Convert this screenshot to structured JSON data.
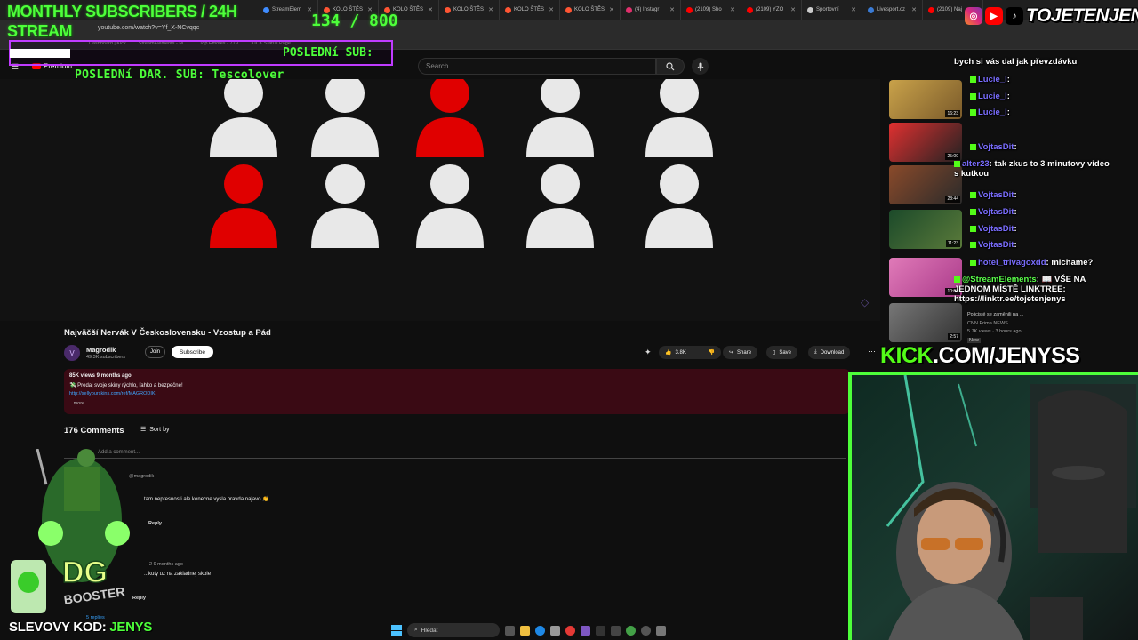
{
  "overlay": {
    "sub_goal_title": "MONTHLY SUBSCRIBERS / 24H",
    "sub_goal_title2": "STREAM",
    "sub_goal_count": "134  / 800",
    "last_sub_label": "POSLEDNí SUB:",
    "last_dar_label": "POSLEDNí DAR. SUB: Tescolover",
    "promo_prefix": "SLEVOVY KOD: ",
    "promo_code": "JENYS",
    "handle": "TOJETENJENYS",
    "kick_prefix": "KICK",
    "kick_suffix": ".COM/JENYSS"
  },
  "browser": {
    "tabs": [
      {
        "label": "StreamElem",
        "color": "#3f8cff"
      },
      {
        "label": "KOLO ŠTĚS",
        "color": "#ff5533"
      },
      {
        "label": "KOLO ŠTĚS",
        "color": "#ff5533"
      },
      {
        "label": "KOLO ŠTĚS",
        "color": "#ff5533"
      },
      {
        "label": "KOLO ŠTĚS",
        "color": "#ff5533"
      },
      {
        "label": "KOLO ŠTĚS",
        "color": "#ff5533"
      },
      {
        "label": "(4) Instagr",
        "color": "#e1306c"
      },
      {
        "label": "(2109) Sho",
        "color": "#ff0000"
      },
      {
        "label": "(2109) YZO",
        "color": "#ff0000"
      },
      {
        "label": "Sportovní",
        "color": "#cccccc"
      },
      {
        "label": "Livesport.cz",
        "color": "#3a7bd5"
      },
      {
        "label": "(2109) Naj",
        "color": "#ff0000"
      }
    ],
    "url": "youtube.com/watch?v=Yf_X-NCvqqc",
    "bookmarks": [
      "Dashboard | Kick",
      "StreamElements - M...",
      "Top Emotes - 7TV",
      "KICK Status Page"
    ]
  },
  "youtube": {
    "premium_label": "Premium",
    "search_placeholder": "Search",
    "video_title": "Najväčší Nervák V Československu - Vzostup a Pád",
    "channel_name": "Magrodik",
    "channel_subs": "49.3K subscribers",
    "join_label": "Join",
    "subscribe_label": "Subscribe",
    "likes": "3.8K",
    "share_label": "Share",
    "save_label": "Save",
    "download_label": "Download",
    "desc_meta": "85K views  9 months ago",
    "desc_line1": "💸 Predaj svoje skiny rýchlo, ľahko a bezpečne!",
    "desc_link": "http://sellyourskins.com/ref/MAGRODIK",
    "desc_more": "...more",
    "comments_count": "176 Comments",
    "sort_label": "Sort by",
    "add_comment_placeholder": "Add a comment...",
    "comments": [
      {
        "author": "@magrodik",
        "text": "tam nepresnosti ale konecne vysla pravda najavo 👏",
        "reply": "Reply"
      },
      {
        "author": "",
        "meta": "2 9 months ago",
        "text": "...kuty uz na zakladnej skole",
        "reply": "Reply"
      }
    ],
    "replies_label": "5 replies"
  },
  "sidebar_videos": [
    {
      "duration": "16:23",
      "colors": [
        "#c9a24a",
        "#7a5a2a"
      ]
    },
    {
      "duration": "25:00",
      "colors": [
        "#e03030",
        "#222"
      ]
    },
    {
      "duration": "28:44",
      "colors": [
        "#8a4a2a",
        "#2a2a2a"
      ]
    },
    {
      "duration": "11:23",
      "colors": [
        "#1c4a2a",
        "#5a7a3a"
      ]
    },
    {
      "duration": "10:08",
      "colors": [
        "#e07ab8",
        "#aa3a8a"
      ]
    },
    {
      "duration": "2:57",
      "colors": [
        "#777",
        "#333"
      ]
    }
  ],
  "sidebar_meta": {
    "cnn_title": "Policisté se zaměnili na ...",
    "cnn_channel": "CNN Prima NEWS",
    "cnn_views": "5.7K views · 3 hours ago",
    "cnn_new": "New"
  },
  "chat": [
    {
      "user": "",
      "text": "bych si vás dal jak převzdávku",
      "color": "white"
    },
    {
      "user": "Lucie_l",
      "text": ":",
      "color": "purple"
    },
    {
      "user": "Lucie_l",
      "text": ":",
      "color": "purple"
    },
    {
      "user": "Lucie_l",
      "text": ":",
      "color": "purple"
    },
    {
      "user": "VojtasDit",
      "text": ":",
      "color": "purple"
    },
    {
      "user": "alter23",
      "text": ": tak zkus to 3 minutovy video s kutkou",
      "color": "purple"
    },
    {
      "user": "VojtasDit",
      "text": ":",
      "color": "purple"
    },
    {
      "user": "VojtasDit",
      "text": ":",
      "color": "purple"
    },
    {
      "user": "VojtasDit",
      "text": ":",
      "color": "purple"
    },
    {
      "user": "VojtasDit",
      "text": ":",
      "color": "purple"
    },
    {
      "user": "hotel_trivagoxdd",
      "text": ": michame?",
      "color": "purple"
    },
    {
      "user": "@StreamElements",
      "text": ": 📖 VŠE NA JEDNOM MÍSTĚ LINKTREE: https://linktr.ee/tojetenjenys",
      "color": "green"
    }
  ],
  "taskbar": {
    "search_label": "Hledat"
  }
}
